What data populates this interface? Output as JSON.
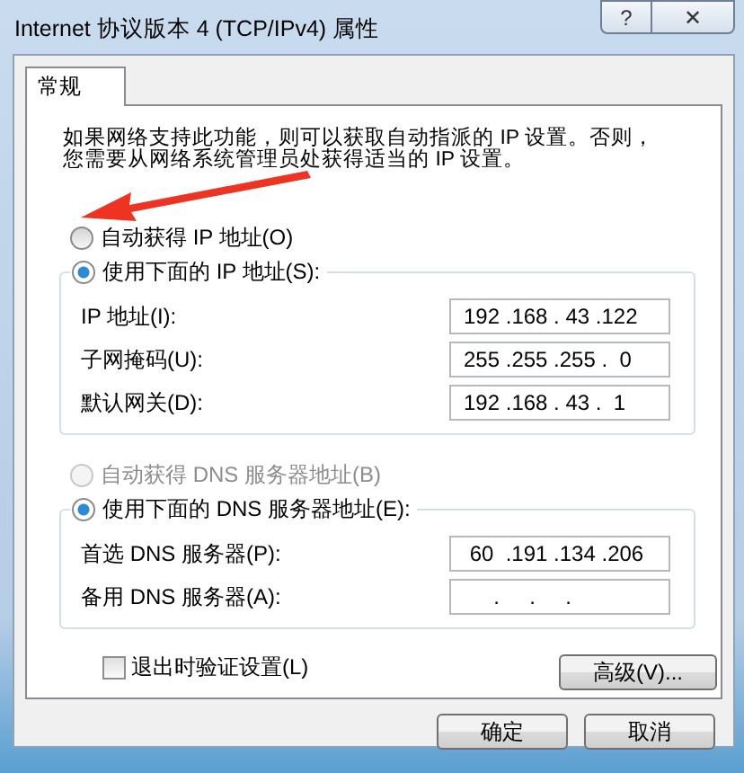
{
  "window": {
    "title": "Internet 协议版本 4 (TCP/IPv4) 属性",
    "help": "?",
    "close": "✕"
  },
  "tabs": [
    {
      "label": "常规",
      "selected": true
    }
  ],
  "description": "如果网络支持此功能，则可以获取自动指派的 IP 设置。否则，您需要从网络系统管理员处获得适当的 IP 设置。",
  "ip_mode": [
    {
      "label": "自动获得 IP 地址(O)",
      "selected": false,
      "disabled": false
    },
    {
      "label": "使用下面的 IP 地址(S):",
      "selected": true,
      "disabled": false
    }
  ],
  "ip_fields": [
    {
      "label": "IP 地址(I):",
      "value": "192 .168 . 43 .122"
    },
    {
      "label": "子网掩码(U):",
      "value": "255 .255 .255 .  0"
    },
    {
      "label": "默认网关(D):",
      "value": "192 .168 . 43 .  1"
    }
  ],
  "dns_mode": [
    {
      "label": "自动获得 DNS 服务器地址(B)",
      "selected": false,
      "disabled": true
    },
    {
      "label": "使用下面的 DNS 服务器地址(E):",
      "selected": true,
      "disabled": false
    }
  ],
  "dns_fields": [
    {
      "label": "首选 DNS 服务器(P):",
      "value": " 60  .191 .134 .206"
    },
    {
      "label": "备用 DNS 服务器(A):",
      "value": "     .     .     ."
    }
  ],
  "validate": {
    "label": "退出时验证设置(L)",
    "checked": false
  },
  "advanced_button": "高级(V)...",
  "buttons": [
    "确定",
    "取消"
  ]
}
